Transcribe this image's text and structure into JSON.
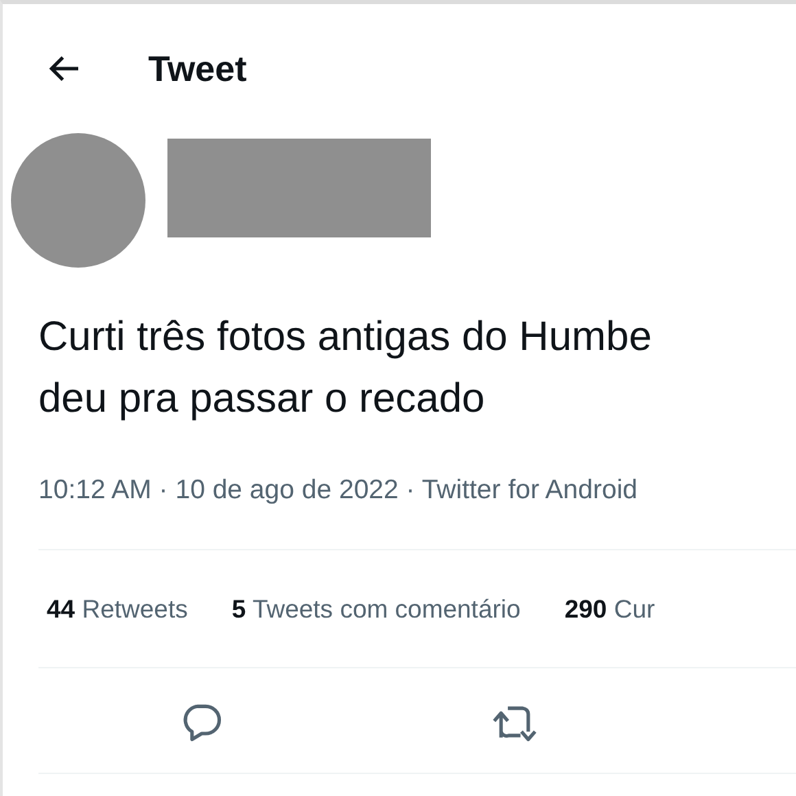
{
  "header": {
    "title": "Tweet"
  },
  "tweet": {
    "text_lines": [
      "Curti três fotos antigas do Humbe",
      "deu pra passar o recado"
    ],
    "meta": "10:12 AM · 10 de ago de 2022 · Twitter for Android",
    "stats": [
      {
        "count": "44",
        "label": "Retweets"
      },
      {
        "count": "5",
        "label": "Tweets com comentário"
      },
      {
        "count": "290",
        "label": "Cur"
      }
    ],
    "actions": [
      {
        "kind": "reply"
      },
      {
        "kind": "retweet"
      }
    ]
  }
}
